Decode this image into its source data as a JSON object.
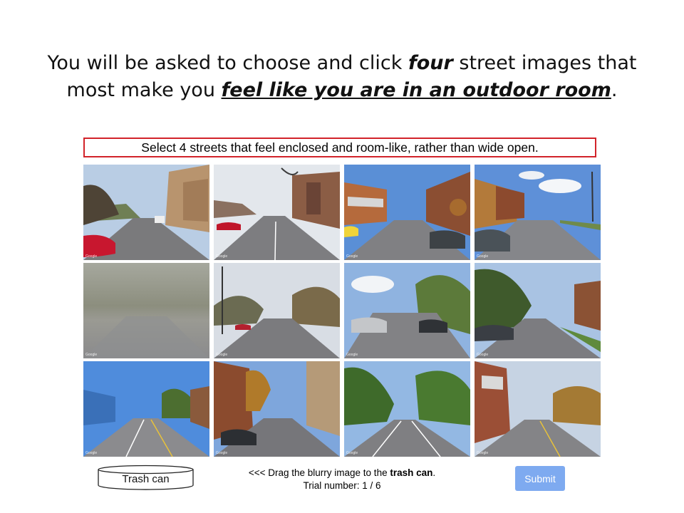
{
  "heading": {
    "line1_pre": "You will be asked to choose and click ",
    "line1_em": "four",
    "line1_post": " street images that",
    "line2_pre": "most make you ",
    "line2_em": "feel like you are in an outdoor room",
    "line2_post": "."
  },
  "instruction": "Select 4 streets that feel enclosed and room-like, rather than wide open.",
  "tiles": [
    {
      "scene": "street-image"
    },
    {
      "scene": "street-image"
    },
    {
      "scene": "street-image"
    },
    {
      "scene": "street-image"
    },
    {
      "scene": "blurry-image"
    },
    {
      "scene": "street-image"
    },
    {
      "scene": "street-image"
    },
    {
      "scene": "street-image"
    },
    {
      "scene": "street-image"
    },
    {
      "scene": "street-image"
    },
    {
      "scene": "street-image"
    },
    {
      "scene": "street-image"
    }
  ],
  "watermark": "Google",
  "trash": {
    "label": "Trash can"
  },
  "footer": {
    "drag_pre": "<<< Drag the blurry image to the ",
    "drag_bold": "trash can",
    "drag_post": ".",
    "trial": "Trial number: 1 / 6"
  },
  "submit_label": "Submit",
  "colors": {
    "instruction_border": "#d2232a",
    "submit_bg": "#7eaaf0"
  }
}
